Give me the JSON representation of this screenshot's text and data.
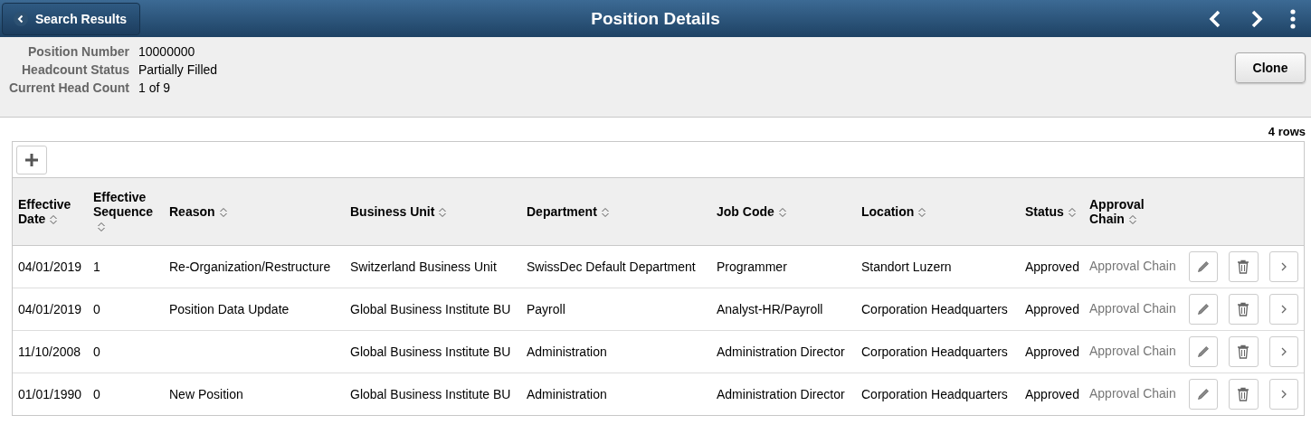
{
  "header": {
    "back_button": "Search Results",
    "title": "Position Details"
  },
  "summary": [
    {
      "label": "Position Number",
      "value": "10000000"
    },
    {
      "label": "Headcount Status",
      "value": "Partially Filled"
    },
    {
      "label": "Current Head Count",
      "value": "1 of 9"
    }
  ],
  "clone_button": "Clone",
  "row_count": "4 rows",
  "table": {
    "columns": [
      {
        "label": "Effective Date"
      },
      {
        "label": "Effective Sequence"
      },
      {
        "label": "Reason"
      },
      {
        "label": "Business Unit"
      },
      {
        "label": "Department"
      },
      {
        "label": "Job Code"
      },
      {
        "label": "Location"
      },
      {
        "label": "Status"
      },
      {
        "label": "Approval Chain"
      }
    ],
    "rows": [
      {
        "effective_date": "04/01/2019",
        "sequence": "1",
        "reason": "Re-Organization/Restructure",
        "business_unit": "Switzerland Business Unit",
        "department": "SwissDec Default Department",
        "job_code": "Programmer",
        "location": "Standort Luzern",
        "status": "Approved",
        "approval_chain": "Approval Chain"
      },
      {
        "effective_date": "04/01/2019",
        "sequence": "0",
        "reason": "Position Data Update",
        "business_unit": "Global Business Institute BU",
        "department": "Payroll",
        "job_code": "Analyst-HR/Payroll",
        "location": "Corporation Headquarters",
        "status": "Approved",
        "approval_chain": "Approval Chain"
      },
      {
        "effective_date": "11/10/2008",
        "sequence": "0",
        "business_unit": "Global Business Institute BU",
        "department": "Administration",
        "job_code": "Administration Director",
        "location": "Corporation Headquarters",
        "status": "Approved",
        "approval_chain": "Approval Chain"
      },
      {
        "effective_date": "01/01/1990",
        "sequence": "0",
        "reason": "New Position",
        "business_unit": "Global Business Institute BU",
        "department": "Administration",
        "job_code": "Administration Director",
        "location": "Corporation Headquarters",
        "status": "Approved",
        "approval_chain": "Approval Chain"
      }
    ]
  }
}
